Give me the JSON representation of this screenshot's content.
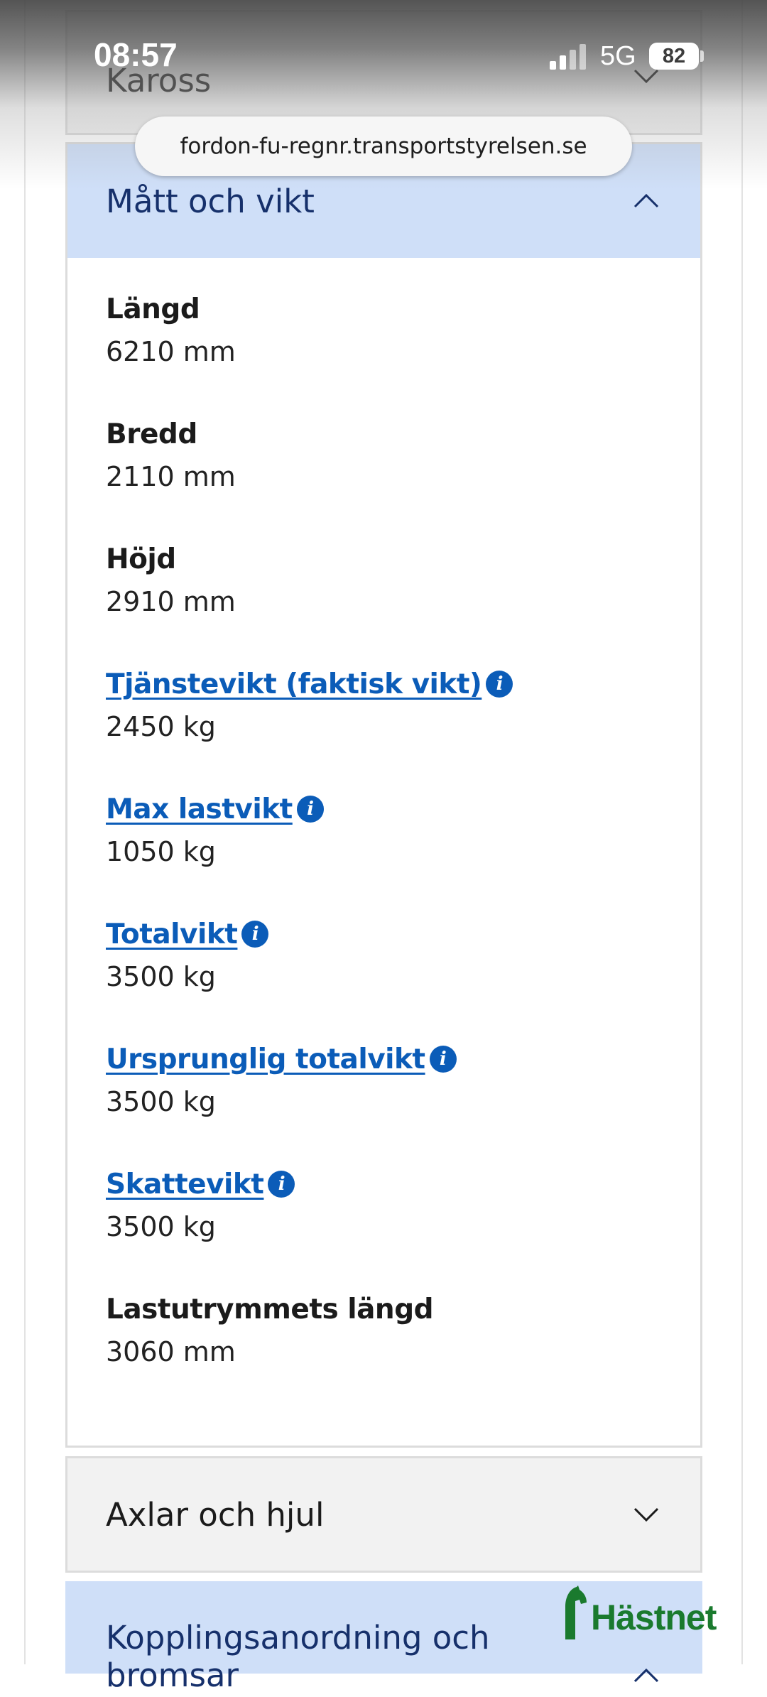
{
  "status_bar": {
    "time": "08:57",
    "network": "5G",
    "battery": "82"
  },
  "browser": {
    "url": "fordon-fu-regnr.transportstyrelsen.se"
  },
  "sections": {
    "kaross": {
      "title": "Kaross"
    },
    "matt": {
      "title": "Mått och vikt",
      "fields": [
        {
          "label": "Längd",
          "value": "6210 mm",
          "link": false
        },
        {
          "label": "Bredd",
          "value": "2110 mm",
          "link": false
        },
        {
          "label": "Höjd",
          "value": "2910 mm",
          "link": false
        },
        {
          "label": "Tjänstevikt (faktisk vikt)",
          "value": "2450 kg",
          "link": true
        },
        {
          "label": "Max lastvikt",
          "value": "1050 kg",
          "link": true
        },
        {
          "label": "Totalvikt",
          "value": "3500 kg",
          "link": true
        },
        {
          "label": "Ursprunglig totalvikt",
          "value": "3500 kg",
          "link": true
        },
        {
          "label": "Skattevikt",
          "value": "3500 kg",
          "link": true
        },
        {
          "label": "Lastutrymmets längd",
          "value": "3060 mm",
          "link": false
        }
      ]
    },
    "axlar": {
      "title": "Axlar och hjul"
    },
    "koppling": {
      "title": "Kopplingsanordning och bromsar"
    }
  },
  "icons": {
    "info": "i"
  },
  "watermark": {
    "text": "Hästnet"
  },
  "colors": {
    "link": "#0b5cb8",
    "header_bg": "#cfdff8",
    "header_text": "#16306b",
    "collapsed_bg": "#f2f2f2",
    "watermark": "#1a7a2e"
  }
}
